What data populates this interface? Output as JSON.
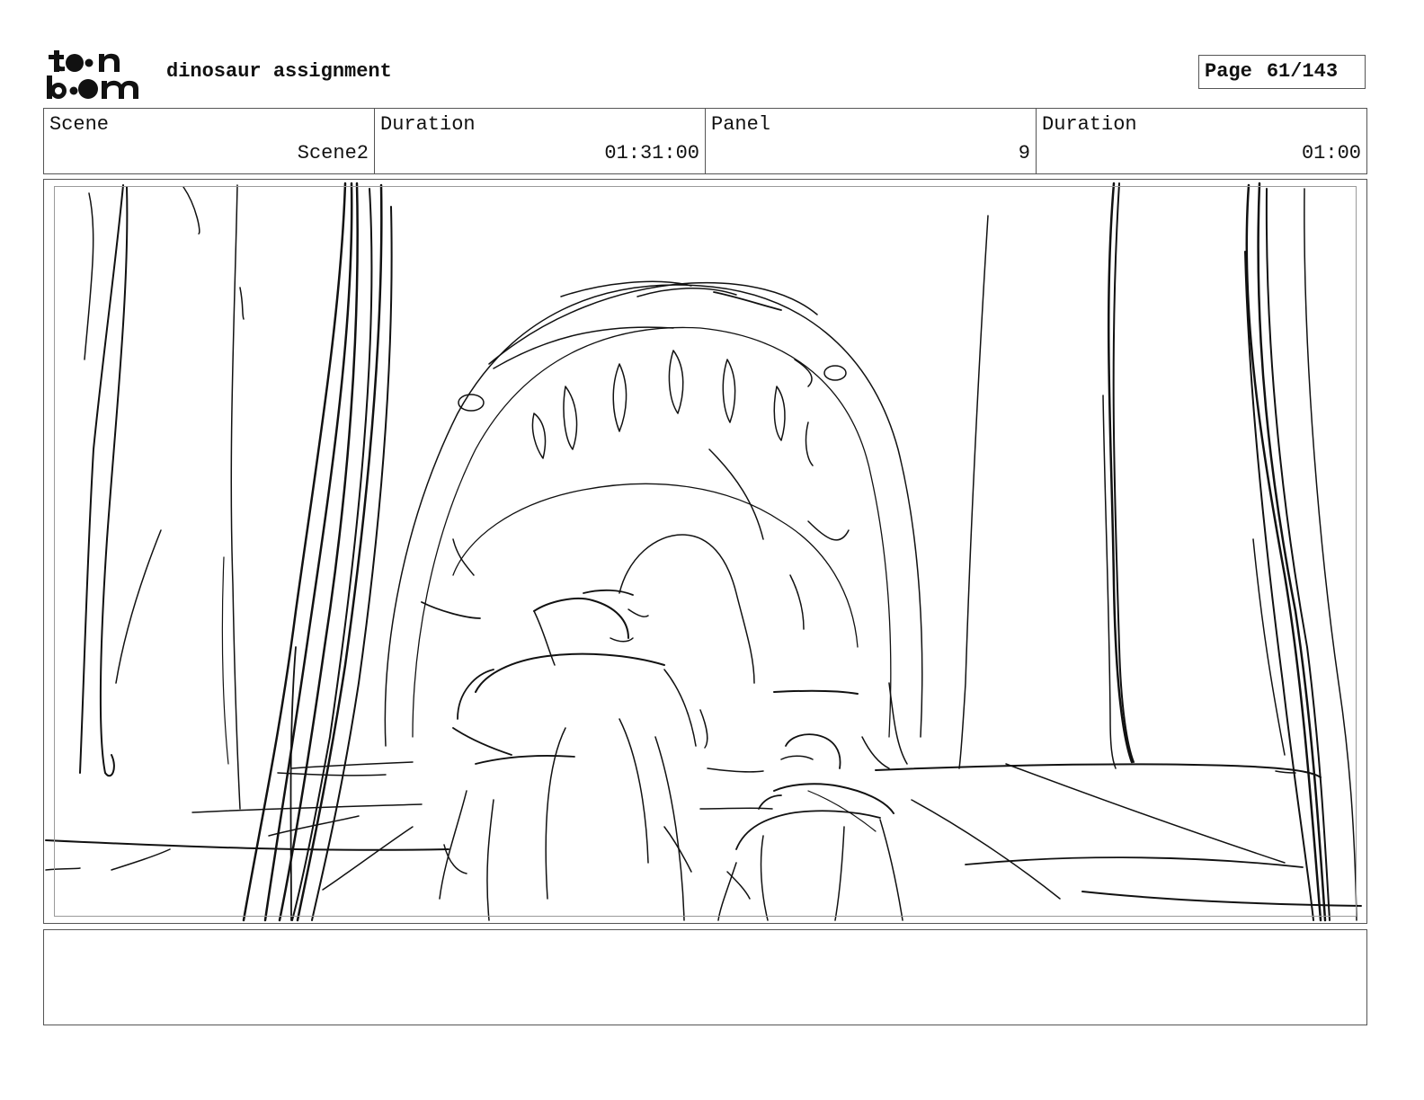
{
  "header": {
    "logo_text": "toon boom",
    "title": "dinosaur assignment",
    "page_label": "Page",
    "page_number": "61/143"
  },
  "info": {
    "scene_label": "Scene",
    "scene_value": "Scene2",
    "scene_duration_label": "Duration",
    "scene_duration_value": "01:31:00",
    "panel_label": "Panel",
    "panel_value": "9",
    "panel_duration_label": "Duration",
    "panel_duration_value": "01:00"
  },
  "notes": {
    "text": ""
  }
}
